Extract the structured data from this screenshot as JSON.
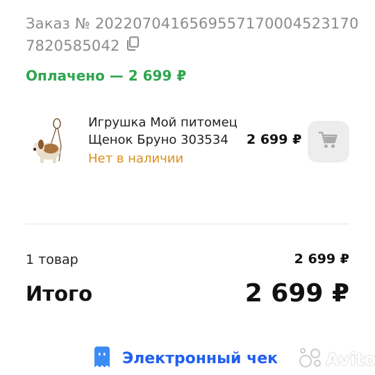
{
  "order": {
    "number_label": "Заказ № 2022070416569557170004523170782058504",
    "number_line1": "Заказ № 20220704165695571700045231707 8",
    "payment_status": "Оплачено — 2 699 ₽"
  },
  "item": {
    "title": "Игрушка Мой питомец Щенок Бруно 303534",
    "availability": "Нет в наличии",
    "price": "2 699 ₽",
    "cart_icon": "cart-icon"
  },
  "summary": {
    "count_label": "1 товар",
    "count_price": "2 699 ₽",
    "total_label": "Итого",
    "total_price": "2 699 ₽"
  },
  "receipt": {
    "label": "Электронный чек",
    "icon": "receipt-icon"
  },
  "watermark": {
    "text": "Avito"
  },
  "colors": {
    "paid": "#2ea64f",
    "unavailable": "#d9901e",
    "link": "#1f5ef0",
    "muted": "#8b8b8b"
  }
}
